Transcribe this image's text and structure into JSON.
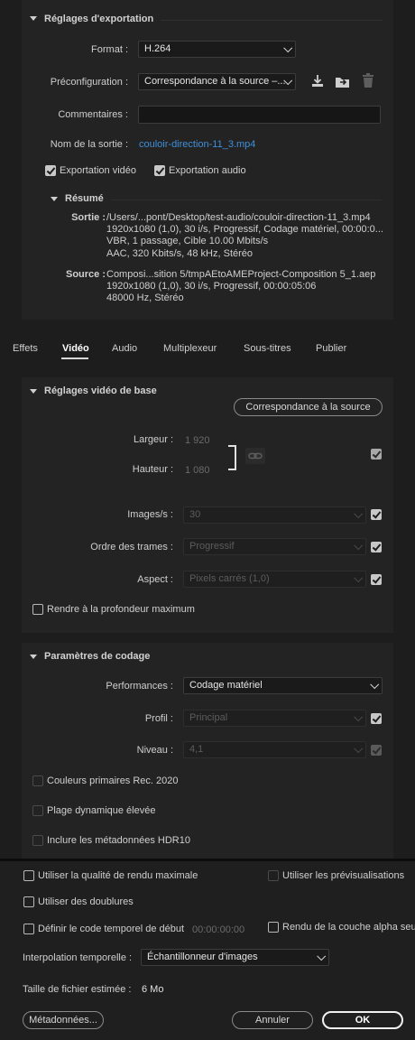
{
  "export_settings": {
    "title": "Réglages d'exportation",
    "format_label": "Format :",
    "format_value": "H.264",
    "preset_label": "Préconfiguration :",
    "preset_value": "Correspondance à la source –...",
    "comments_label": "Commentaires :",
    "comments_value": "",
    "output_name_label": "Nom de la sortie :",
    "output_name_value": "couloir-direction-11_3.mp4",
    "export_video_label": "Exportation vidéo",
    "export_audio_label": "Exportation audio",
    "summary_title": "Résumé",
    "output_key": "Sortie :",
    "output_lines": [
      "/Users/...pont/Desktop/test-audio/couloir-direction-11_3.mp4",
      "1920x1080 (1,0), 30 i/s, Progressif, Codage matériel, 00:00:0...",
      "VBR, 1 passage, Cible 10.00  Mbits/s",
      "AAC, 320  Kbits/s, 48 kHz, Stéréo"
    ],
    "source_key": "Source :",
    "source_lines": [
      "Composi...sition 5/tmpAEtoAMEProject-Composition 5_1.aep",
      "1920x1080 (1,0), 30 i/s, Progressif, 00:00:05:06",
      "48000 Hz, Stéréo"
    ]
  },
  "tabs": [
    "Effets",
    "Vidéo",
    "Audio",
    "Multiplexeur",
    "Sous-titres",
    "Publier"
  ],
  "video_basic": {
    "title": "Réglages vidéo de base",
    "match_source_button": "Correspondance à la source",
    "width_label": "Largeur :",
    "width_value": "1 920",
    "height_label": "Hauteur :",
    "height_value": "1 080",
    "fps_label": "Images/s :",
    "fps_value": "30",
    "field_order_label": "Ordre des trames :",
    "field_order_value": "Progressif",
    "aspect_label": "Aspect :",
    "aspect_value": "Pixels carrés (1,0)",
    "render_max_depth_label": "Rendre à la profondeur maximum"
  },
  "encoding": {
    "title": "Paramètres de codage",
    "performance_label": "Performances :",
    "performance_value": "Codage matériel",
    "profile_label": "Profil :",
    "profile_value": "Principal",
    "level_label": "Niveau :",
    "level_value": "4,1",
    "rec2020_label": "Couleurs primaires Rec. 2020",
    "hdr_label": "Plage dynamique élevée",
    "hdr10_label": "Inclure les métadonnées HDR10"
  },
  "footer": {
    "max_quality_label": "Utiliser la qualité de rendu maximale",
    "use_previews_label": "Utiliser les prévisualisations",
    "use_proxies_label": "Utiliser des doublures",
    "start_timecode_label": "Définir le code temporel de début",
    "start_timecode_value": "00:00:00:00",
    "alpha_label": "Rendu de la couche alpha seul",
    "interpolation_label": "Interpolation temporelle :",
    "interpolation_value": "Échantillonneur d'images",
    "file_size_label": "Taille de fichier estimée :",
    "file_size_value": "6 Mo",
    "metadata_button": "Métadonnées...",
    "cancel_button": "Annuler",
    "ok_button": "OK"
  },
  "colors": {
    "accent_link": "#3f8fd8",
    "panel": "#232323",
    "background": "#1d1d1d"
  }
}
